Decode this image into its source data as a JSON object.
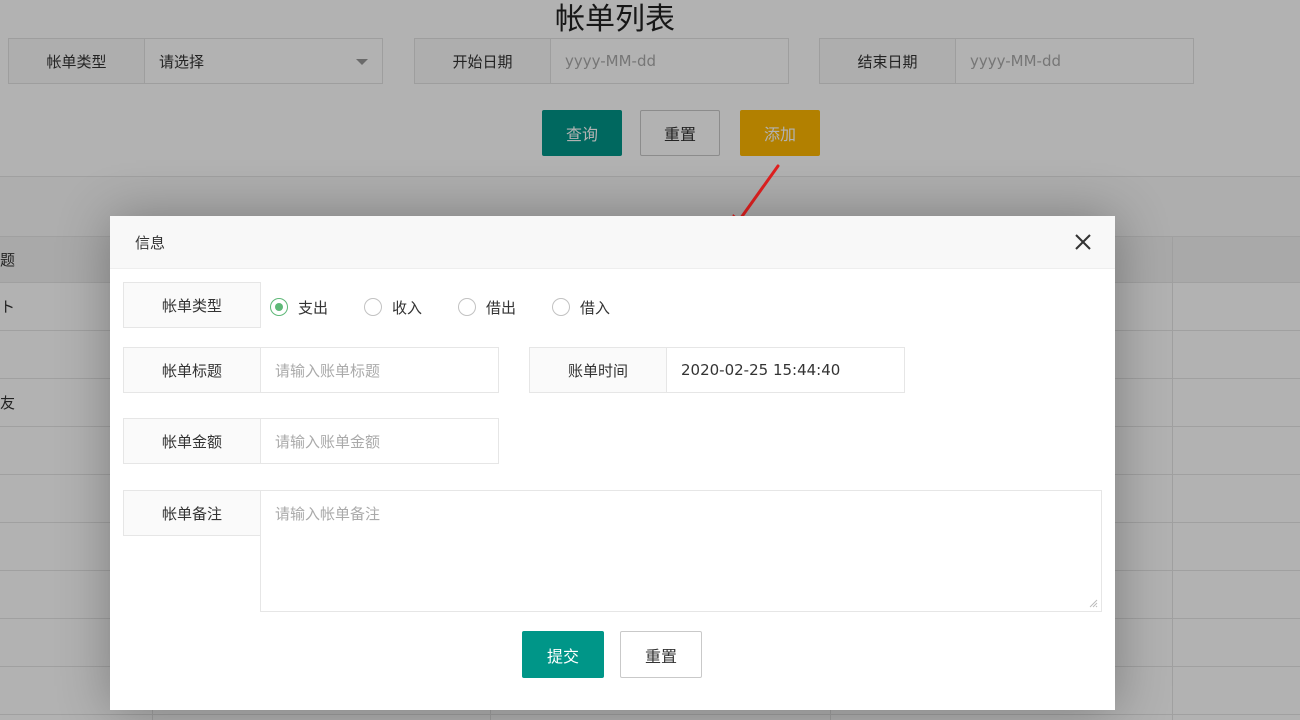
{
  "page": {
    "title": "帐单列表"
  },
  "filters": [
    {
      "label": "帐单类型",
      "value": "请选择"
    },
    {
      "label": "开始日期",
      "placeholder": "yyyy-MM-dd"
    },
    {
      "label": "结束日期",
      "placeholder": "yyyy-MM-dd"
    }
  ],
  "actions": {
    "query": "查询",
    "reset": "重置",
    "add": "添加"
  },
  "table": {
    "header_fragment": "题",
    "row_fragments": [
      "ト",
      "",
      "友",
      "",
      "",
      "",
      "",
      "",
      ""
    ]
  },
  "modal": {
    "title": "信息",
    "type_label": "帐单类型",
    "type_options": [
      {
        "label": "支出",
        "checked": true
      },
      {
        "label": "收入",
        "checked": false
      },
      {
        "label": "借出",
        "checked": false
      },
      {
        "label": "借入",
        "checked": false
      }
    ],
    "title_label": "帐单标题",
    "title_placeholder": "请输入账单标题",
    "time_label": "账单时间",
    "time_value": "2020-02-25 15:44:40",
    "amount_label": "帐单金额",
    "amount_placeholder": "请输入账单金额",
    "remark_label": "帐单备注",
    "remark_placeholder": "请输入帐单备注",
    "submit": "提交",
    "reset": "重置"
  },
  "colors": {
    "primary": "#009688",
    "warm": "#ffb800",
    "radio_checked": "#5fb878",
    "arrow": "#e02020"
  }
}
